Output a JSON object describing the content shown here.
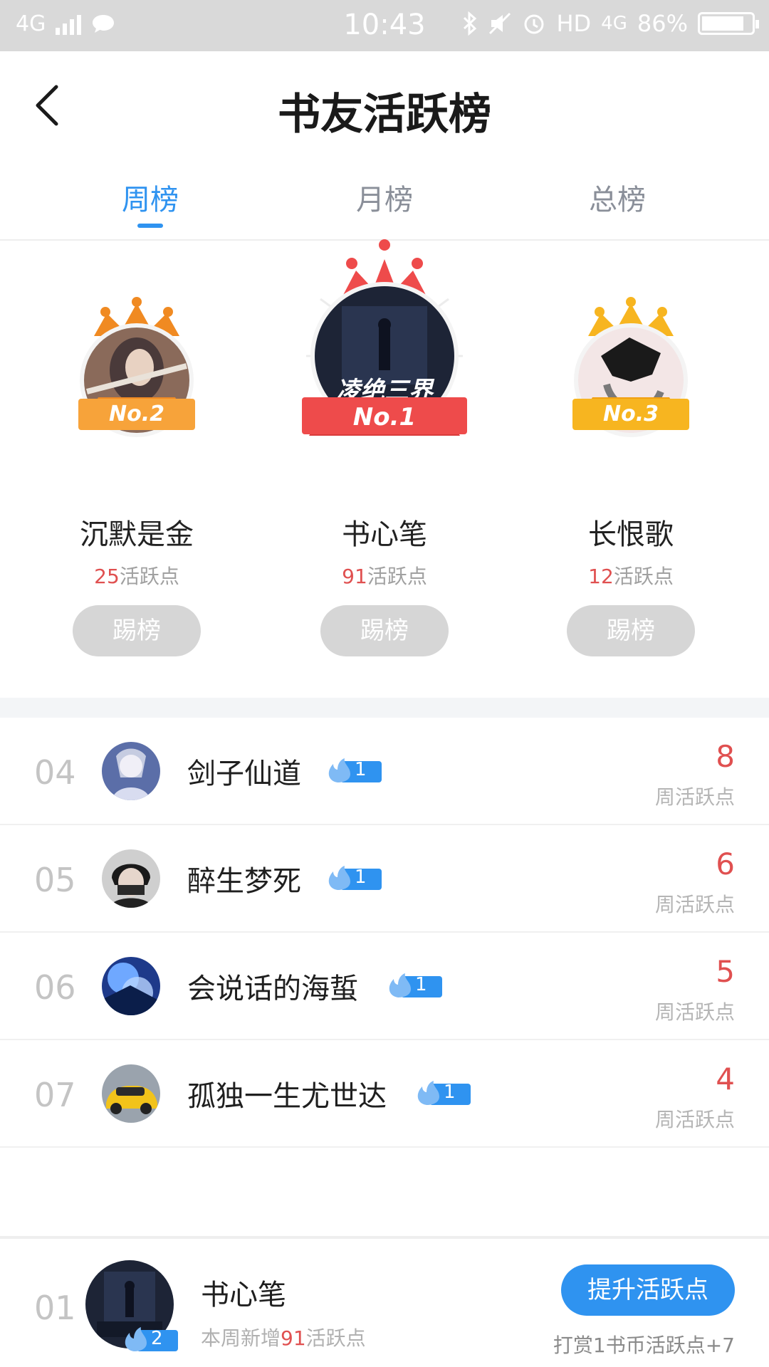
{
  "status_bar": {
    "network": "4G",
    "time": "10:43",
    "hd": "HD",
    "network_right": "4G",
    "battery": "86%",
    "battery_level": 0.86
  },
  "header": {
    "title": "书友活跃榜"
  },
  "tabs": [
    {
      "label": "周榜",
      "active": true
    },
    {
      "label": "月榜",
      "active": false
    },
    {
      "label": "总榜",
      "active": false
    }
  ],
  "podium": [
    {
      "rank_label": "No.2",
      "name": "沉默是金",
      "points": "25",
      "points_unit": "活跃点",
      "button": "踢榜"
    },
    {
      "rank_label": "No.1",
      "name": "书心笔",
      "points": "91",
      "points_unit": "活跃点",
      "button": "踢榜",
      "cover_text": "凌绝三界"
    },
    {
      "rank_label": "No.3",
      "name": "长恨歌",
      "points": "12",
      "points_unit": "活跃点",
      "button": "踢榜"
    }
  ],
  "rank_list": [
    {
      "rank": "04",
      "name": "剑子仙道",
      "level": "1",
      "score": "8",
      "score_label": "周活跃点"
    },
    {
      "rank": "05",
      "name": "醉生梦死",
      "level": "1",
      "score": "6",
      "score_label": "周活跃点"
    },
    {
      "rank": "06",
      "name": "会说话的海蜇",
      "level": "1",
      "score": "5",
      "score_label": "周活跃点"
    },
    {
      "rank": "07",
      "name": "孤独一生尤世达",
      "level": "1",
      "score": "4",
      "score_label": "周活跃点"
    }
  ],
  "my_entry": {
    "rank": "01",
    "name": "书心笔",
    "level": "2",
    "sub_prefix": "本周新增",
    "sub_points": "91",
    "sub_suffix": "活跃点",
    "button": "提升活跃点",
    "note": "打赏1书币活跃点+7"
  },
  "colors": {
    "accent": "#2f93f0",
    "points": "#e05050",
    "gold": "#f7a31a",
    "orange": "#f08a22",
    "red": "#ee4b4b"
  }
}
